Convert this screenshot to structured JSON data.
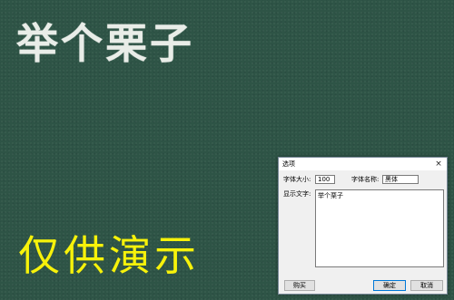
{
  "background": {
    "heading": "举个栗子",
    "demo_label": "仅供演示",
    "colors": {
      "board": "#2e5446",
      "heading": "#e9ede8",
      "demo": "#f7f20a"
    }
  },
  "dialog": {
    "title": "选项",
    "close_icon": "×",
    "font_size_label": "字体大小:",
    "font_size_value": "100",
    "font_name_label": "字体名称:",
    "font_name_value": "黑体",
    "display_text_label": "显示文字:",
    "display_text_value": "举个栗子",
    "buy_label": "购买",
    "ok_label": "确定",
    "cancel_label": "取消"
  }
}
